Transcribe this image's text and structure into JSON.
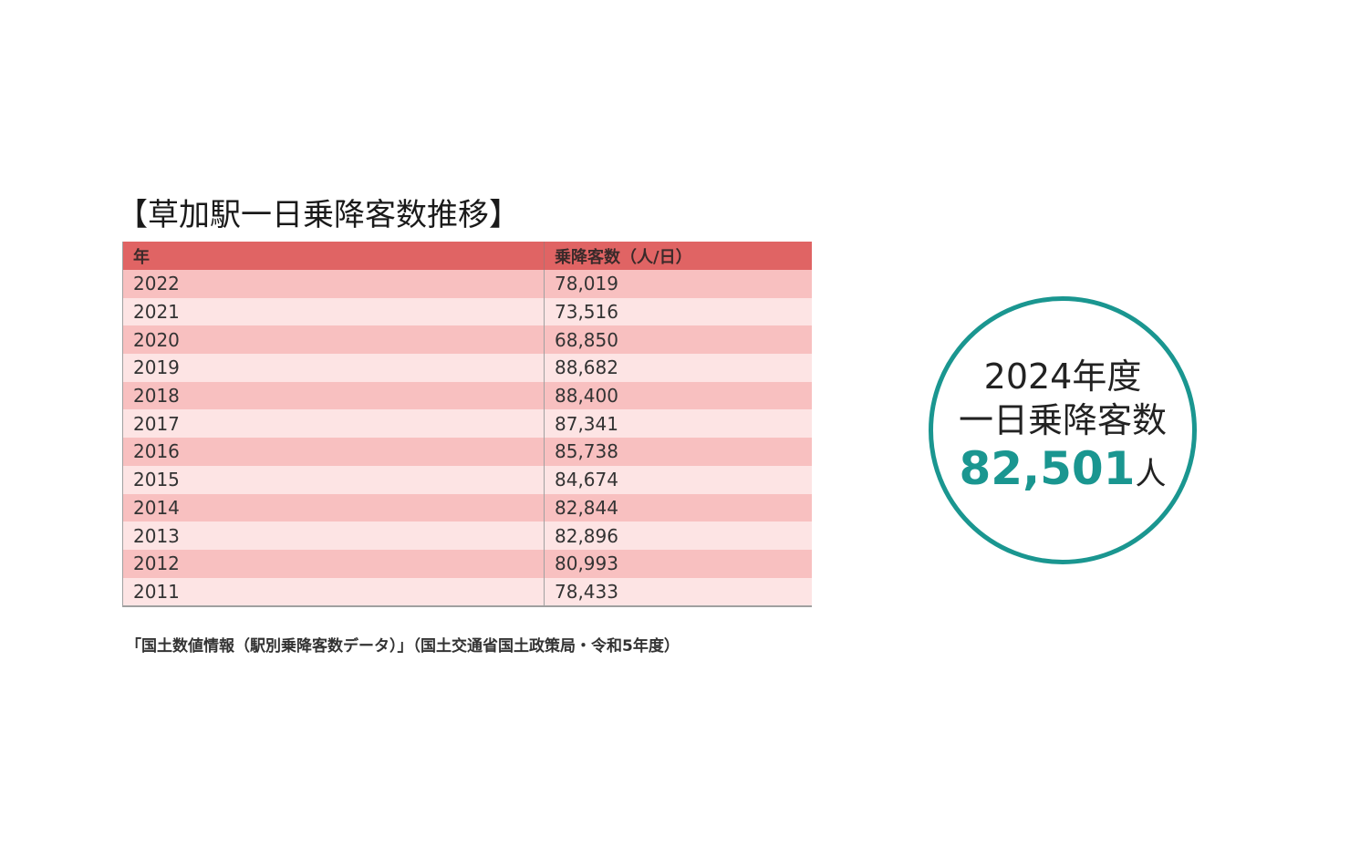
{
  "title": "【草加駅一日乗降客数推移】",
  "table": {
    "headers": [
      "年",
      "乗降客数（人/日）"
    ],
    "rows": [
      [
        "2022",
        "78,019"
      ],
      [
        "2021",
        "73,516"
      ],
      [
        "2020",
        "68,850"
      ],
      [
        "2019",
        "88,682"
      ],
      [
        "2018",
        "88,400"
      ],
      [
        "2017",
        "87,341"
      ],
      [
        "2016",
        "85,738"
      ],
      [
        "2015",
        "84,674"
      ],
      [
        "2014",
        "82,844"
      ],
      [
        "2013",
        "82,896"
      ],
      [
        "2012",
        "80,993"
      ],
      [
        "2011",
        "78,433"
      ]
    ]
  },
  "source": "「国土数値情報（駅別乗降客数データ）」（国土交通省国土政策局・令和5年度）",
  "highlight": {
    "line1": "2024年度",
    "line2": "一日乗降客数",
    "value": "82,501",
    "unit": "人"
  },
  "colors": {
    "header_bg": "#e06464",
    "row_odd": "#f8c0c0",
    "row_even": "#fde4e4",
    "accent": "#1a9690"
  }
}
